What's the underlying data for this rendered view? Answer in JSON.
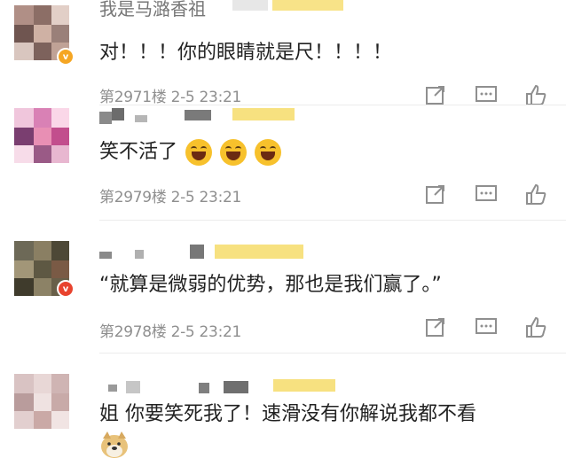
{
  "colors": {
    "text": "#222222",
    "meta": "#8f8f8f",
    "icon": "#8f8f8f",
    "blur_yellow": "#f6dc6a",
    "divider": "#ececec"
  },
  "comments": [
    {
      "text": "对！！！你的眼睛就是尺！！！！",
      "meta": "第2971楼 2-5 23:21",
      "badge": "v"
    },
    {
      "text": "笑不活了",
      "meta": "第2979楼 2-5 23:21",
      "emoji": [
        "laugh-emoji",
        "laugh-emoji",
        "laugh-emoji"
      ]
    },
    {
      "text": "“就算是微弱的优势，那也是我们赢了。”",
      "meta": "第2978楼 2-5 23:21",
      "badge": "v"
    },
    {
      "text": "姐 你要笑死我了！速滑没有你解说我都不看",
      "emoji": [
        "doge-emoji"
      ]
    }
  ],
  "icons": {
    "share": "share-icon",
    "comment": "comment-icon",
    "like": "like-icon"
  },
  "first_comment_username_partial": "我是马潞香祖"
}
